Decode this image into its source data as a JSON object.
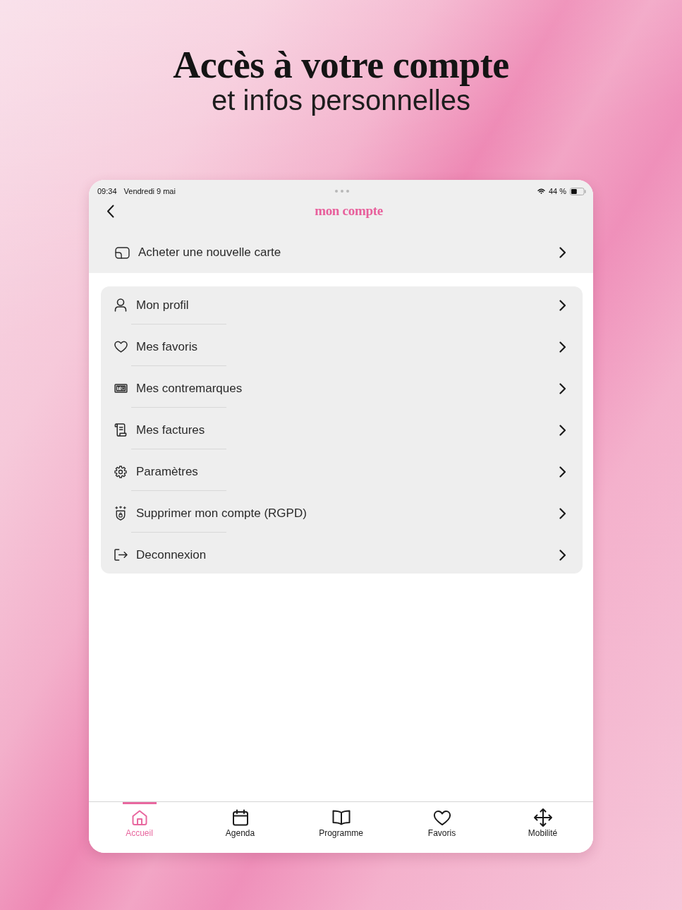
{
  "headline": {
    "title": "Accès à votre compte",
    "subtitle": "et infos personnelles"
  },
  "status_bar": {
    "time": "09:34",
    "date": "Vendredi 9 mai",
    "battery": "44 %"
  },
  "nav_bar": {
    "title": "mon compte"
  },
  "top_action": {
    "label": "Acheter une nouvelle carte"
  },
  "menu": {
    "items": [
      {
        "label": "Mon profil"
      },
      {
        "label": "Mes favoris"
      },
      {
        "label": "Mes contremarques"
      },
      {
        "label": "Mes factures"
      },
      {
        "label": "Paramètres"
      },
      {
        "label": "Supprimer mon compte (RGPD)"
      },
      {
        "label": "Deconnexion"
      }
    ]
  },
  "tab_bar": {
    "tabs": [
      {
        "label": "Accueil",
        "selected": true
      },
      {
        "label": "Agenda",
        "selected": false
      },
      {
        "label": "Programme",
        "selected": false
      },
      {
        "label": "Favoris",
        "selected": false
      },
      {
        "label": "Mobilité",
        "selected": false
      }
    ]
  }
}
